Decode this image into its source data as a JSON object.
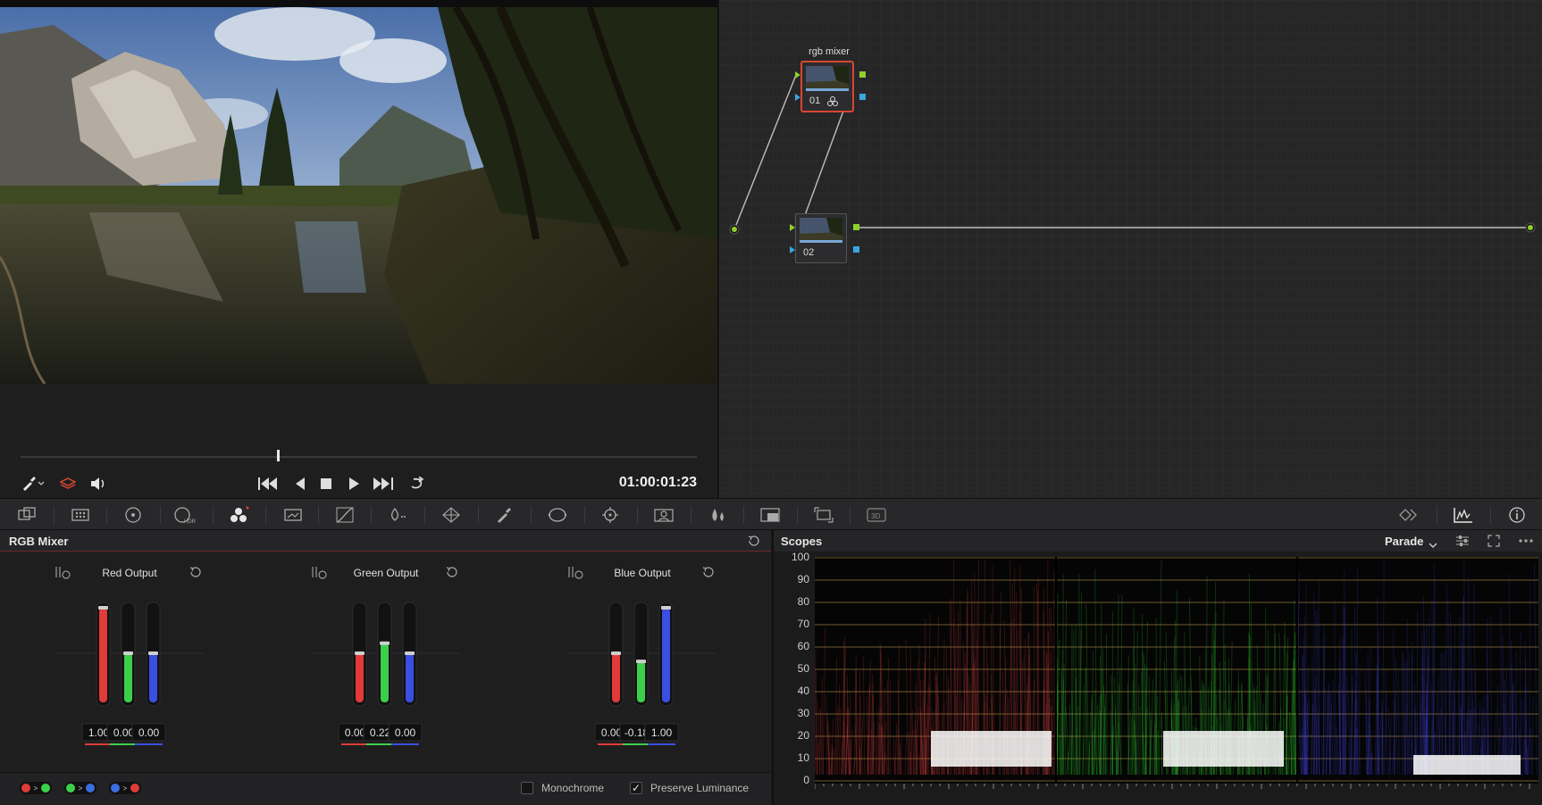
{
  "node_editor": {
    "node1": {
      "title": "rgb mixer",
      "number": "01"
    },
    "node2": {
      "number": "02"
    }
  },
  "viewer": {
    "timecode": "01:00:01:23",
    "playhead_fraction": 0.38
  },
  "mixer": {
    "title": "RGB Mixer",
    "groups": [
      {
        "title": "Red Output",
        "values": [
          "1.00",
          "0.00",
          "0.00"
        ]
      },
      {
        "title": "Green Output",
        "values": [
          "0.00",
          "0.22",
          "0.00"
        ]
      },
      {
        "title": "Blue Output",
        "values": [
          "0.00",
          "-0.18",
          "1.00"
        ]
      }
    ],
    "monochrome_label": "Monochrome",
    "monochrome_checked": false,
    "preserve_luminance_label": "Preserve Luminance",
    "preserve_luminance_checked": true
  },
  "scopes": {
    "title": "Scopes",
    "mode": "Parade",
    "y_labels": [
      "100",
      "90",
      "80",
      "70",
      "60",
      "50",
      "40",
      "30",
      "20",
      "10",
      "0"
    ]
  },
  "colors": {
    "red": "#e03a3a",
    "green": "#3bd04a",
    "blue": "#3a4ee0",
    "accent_red": "#d9472f"
  }
}
